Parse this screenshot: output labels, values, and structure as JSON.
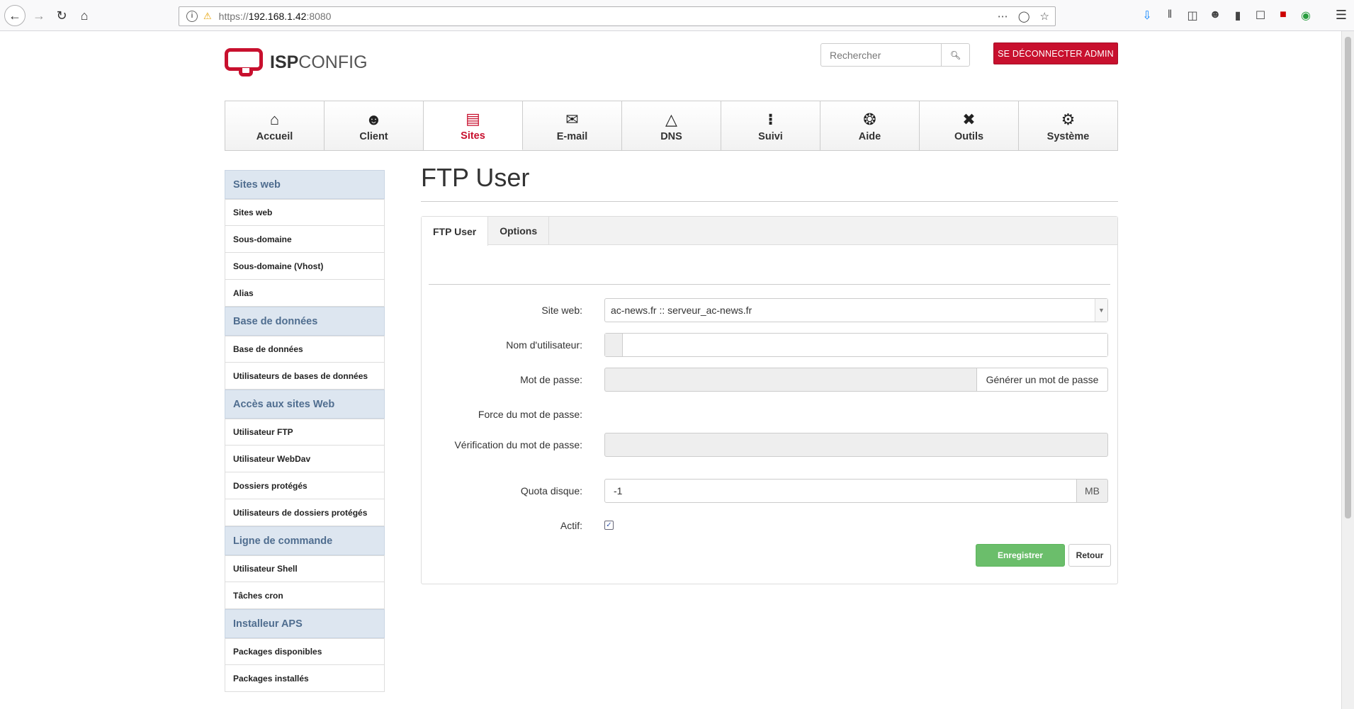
{
  "browser": {
    "url_prefix": "https://",
    "url_host": "192.168.1.42",
    "url_port": ":8080"
  },
  "header": {
    "logo_isp": "ISP",
    "logo_config": "CONFIG",
    "search_placeholder": "Rechercher",
    "logout_label": "SE DÉCONNECTER ADMIN"
  },
  "nav": {
    "items": [
      {
        "label": "Accueil",
        "icon": "home-icon"
      },
      {
        "label": "Client",
        "icon": "users-icon"
      },
      {
        "label": "Sites",
        "icon": "sites-icon"
      },
      {
        "label": "E-mail",
        "icon": "email-icon"
      },
      {
        "label": "DNS",
        "icon": "dns-icon"
      },
      {
        "label": "Suivi",
        "icon": "traffic-light-icon"
      },
      {
        "label": "Aide",
        "icon": "lifebuoy-icon"
      },
      {
        "label": "Outils",
        "icon": "tools-icon"
      },
      {
        "label": "Système",
        "icon": "gear-icon"
      }
    ],
    "active": "Sites"
  },
  "sidebar": {
    "sections": [
      {
        "title": "Sites web",
        "items": [
          "Sites web",
          "Sous-domaine",
          "Sous-domaine (Vhost)",
          "Alias"
        ]
      },
      {
        "title": "Base de données",
        "items": [
          "Base de données",
          "Utilisateurs de bases de données"
        ]
      },
      {
        "title": "Accès aux sites Web",
        "items": [
          "Utilisateur FTP",
          "Utilisateur WebDav",
          "Dossiers protégés",
          "Utilisateurs de dossiers protégés"
        ]
      },
      {
        "title": "Ligne de commande",
        "items": [
          "Utilisateur Shell",
          "Tâches cron"
        ]
      },
      {
        "title": "Installeur APS",
        "items": [
          "Packages disponibles",
          "Packages installés"
        ]
      }
    ]
  },
  "content": {
    "title": "FTP User",
    "tabs": [
      "FTP User",
      "Options"
    ],
    "form": {
      "site_label": "Site web:",
      "site_value": "ac-news.fr :: serveur_ac-news.fr",
      "username_label": "Nom d'utilisateur:",
      "username_value": "",
      "password_label": "Mot de passe:",
      "generate_label": "Générer un mot de passe",
      "strength_label": "Force du mot de passe:",
      "verify_label": "Vérification du mot de passe:",
      "quota_label": "Quota disque:",
      "quota_value": "-1",
      "quota_unit": "MB",
      "active_label": "Actif:",
      "active_checked": true
    },
    "save_label": "Enregistrer",
    "back_label": "Retour"
  }
}
